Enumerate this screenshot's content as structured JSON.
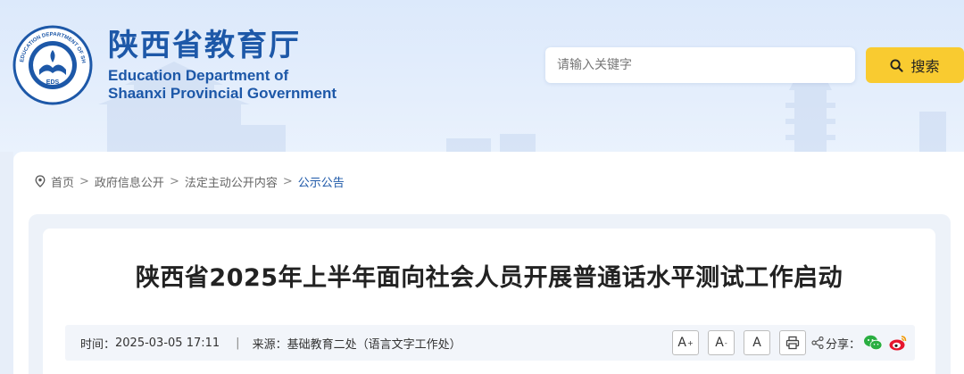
{
  "header": {
    "logo_cn": "陕西省教育厅",
    "logo_en_line1": "Education Department of",
    "logo_en_line2": "Shaanxi Provincial Government",
    "emblem_text": "EDUCATION DEPARTMENT OF SHAANXI",
    "emblem_abbr": "EDS",
    "emblem_cn": "陕西省教育厅"
  },
  "search": {
    "placeholder": "请输入关键字",
    "button_label": "搜索"
  },
  "breadcrumb": {
    "items": [
      "首页",
      "政府信息公开",
      "法定主动公开内容",
      "公示公告"
    ],
    "separator": ">"
  },
  "article": {
    "title": "陕西省2025年上半年面向社会人员开展普通话水平测试工作启动",
    "time_label": "时间：",
    "time_value": "2025-03-05 17:11",
    "divider": "|",
    "source_label": "来源：",
    "source_value": "基础教育二处（语言文字工作处）"
  },
  "tools": {
    "font_increase": "A",
    "font_increase_sup": "+",
    "font_decrease": "A",
    "font_decrease_sup": "-",
    "font_default": "A",
    "print_icon": "printer-icon",
    "share_label": "分享：",
    "wechat_icon": "wechat-icon",
    "weibo_icon": "weibo-icon"
  },
  "colors": {
    "brand_blue": "#1d58a8",
    "search_button": "#f9cb30",
    "header_bg": "#dce9fb"
  }
}
